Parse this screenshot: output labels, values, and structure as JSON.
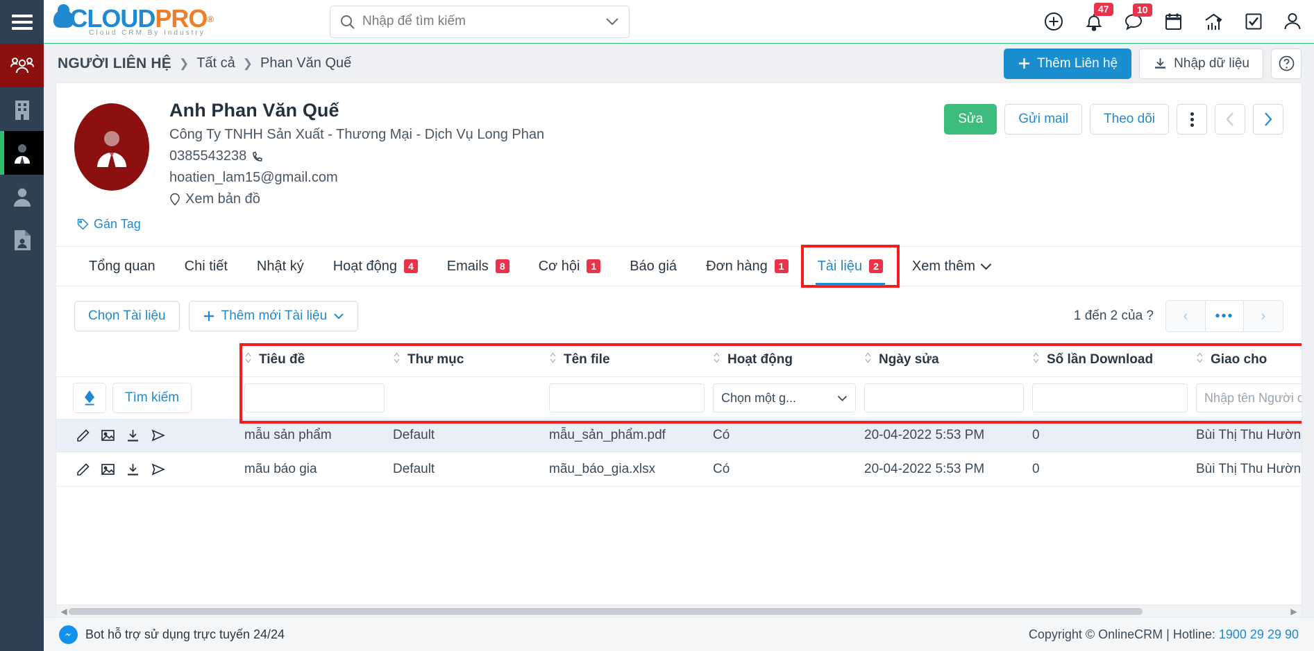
{
  "brand": {
    "logo_cloud": "CLOUD",
    "logo_pro": "PRO",
    "logo_reg": "®",
    "logo_sub": "Cloud CRM By Industry"
  },
  "search": {
    "placeholder": "Nhập để tìm kiếm",
    "value": ""
  },
  "topbar_icons": [
    {
      "name": "add-circle-icon",
      "badge": ""
    },
    {
      "name": "bell-icon",
      "badge": "47"
    },
    {
      "name": "chat-icon",
      "badge": "10"
    },
    {
      "name": "calendar-icon",
      "badge": ""
    },
    {
      "name": "analytics-icon",
      "badge": ""
    },
    {
      "name": "task-check-icon",
      "badge": ""
    },
    {
      "name": "user-account-icon",
      "badge": ""
    }
  ],
  "sidebar": {
    "items": [
      {
        "name": "contacts-group-icon",
        "label": "Người liên hệ"
      },
      {
        "name": "company-building-icon",
        "label": "Công ty"
      },
      {
        "name": "contact-person-icon",
        "label": "Liên hệ"
      },
      {
        "name": "lead-person-icon",
        "label": "Khách hàng tiềm năng"
      },
      {
        "name": "document-person-icon",
        "label": "Hồ sơ"
      }
    ]
  },
  "breadcrumb": {
    "items": [
      "NGƯỜI LIÊN HỆ",
      "Tất cả",
      "Phan Văn Quế"
    ],
    "separator": "❯"
  },
  "header_actions": {
    "add_contact": "Thêm Liên hệ",
    "import": "Nhập dữ liệu",
    "help": "?"
  },
  "profile": {
    "name": "Anh Phan Văn Quế",
    "company": "Công Ty TNHH Sản Xuất - Thương Mại - Dịch Vụ Long Phan",
    "phone": "0385543238",
    "email": "hoatien_lam15@gmail.com",
    "map_link": "Xem bản đồ",
    "tag_link": "Gán Tag",
    "actions": {
      "edit": "Sửa",
      "send_mail": "Gửi mail",
      "follow": "Theo dõi"
    }
  },
  "tabs": [
    {
      "label": "Tổng quan",
      "badge": "",
      "active": false
    },
    {
      "label": "Chi tiết",
      "badge": "",
      "active": false
    },
    {
      "label": "Nhật ký",
      "badge": "",
      "active": false
    },
    {
      "label": "Hoạt động",
      "badge": "4",
      "active": false
    },
    {
      "label": "Emails",
      "badge": "8",
      "active": false
    },
    {
      "label": "Cơ hội",
      "badge": "1",
      "active": false
    },
    {
      "label": "Báo giá",
      "badge": "",
      "active": false
    },
    {
      "label": "Đơn hàng",
      "badge": "1",
      "active": false
    },
    {
      "label": "Tài liệu",
      "badge": "2",
      "active": true
    },
    {
      "label": "Xem thêm",
      "badge": "",
      "active": false
    }
  ],
  "toolbar": {
    "select_doc": "Chọn Tài liệu",
    "add_doc": "Thêm mới Tài liệu",
    "pager_label": "1 đến 2 của ?",
    "pager_prev": "‹",
    "pager_mid": "•••",
    "pager_next": "›"
  },
  "table": {
    "columns": [
      "Tiêu đề",
      "Thư mục",
      "Tên file",
      "Hoạt động",
      "Ngày sửa",
      "Số lần Download",
      "Giao cho"
    ],
    "search_button": "Tìm kiếm",
    "filters": {
      "tieu_de": "",
      "thu_muc": "",
      "ten_file": "",
      "hoat_dong": "Chọn một g...",
      "ngay_sua": "",
      "so_lan_download": "",
      "giao_cho_placeholder": "Nhập tên Người c"
    },
    "rows": [
      {
        "tieu_de": "mẫu sản phẩm",
        "thu_muc": "Default",
        "ten_file": "mẫu_sản_phẩm.pdf",
        "hoat_dong": "Có",
        "ngay_sua": "20-04-2022 5:53 PM",
        "so_lan_download": "0",
        "giao_cho": "Bùi Thị Thu Hường"
      },
      {
        "tieu_de": "mãu báo gia",
        "thu_muc": "Default",
        "ten_file": "mãu_báo_gia.xlsx",
        "hoat_dong": "Có",
        "ngay_sua": "20-04-2022 5:53 PM",
        "so_lan_download": "0",
        "giao_cho": "Bùi Thị Thu Hường"
      }
    ],
    "row_icons": [
      "edit-pencil-icon",
      "image-icon",
      "download-icon",
      "send-icon"
    ]
  },
  "footer": {
    "bot_text": "Bot hỗ trợ sử dụng trực tuyến 24/24",
    "copyright": "Copyright © OnlineCRM | Hotline: ",
    "hotline": "1900 29 29 90"
  },
  "colors": {
    "accent_blue": "#2189cf",
    "green": "#3dbd7d",
    "badge_red": "#e8334a",
    "highlight_red": "#f81d1d",
    "rail_dark": "#2e4052",
    "rail_active_red": "#8c1010",
    "orange": "#f07d2a"
  }
}
